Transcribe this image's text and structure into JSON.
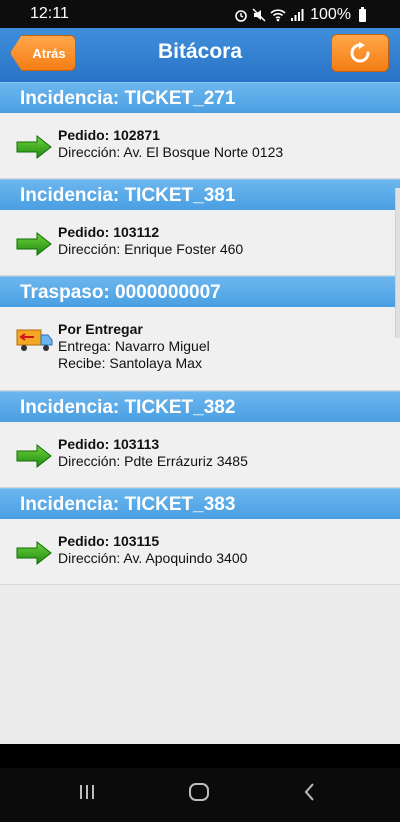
{
  "status": {
    "time": "12:11",
    "battery": "100%"
  },
  "header": {
    "back_label": "Atrás",
    "title": "Bitácora"
  },
  "sections": [
    {
      "title": "Incidencia: TICKET_271",
      "line1": "Pedido: 102871",
      "line2": "Dirección: Av. El Bosque Norte 0123"
    },
    {
      "title": "Incidencia: TICKET_381",
      "line1": "Pedido: 103112",
      "line2": "Dirección: Enrique Foster 460"
    },
    {
      "title": "Traspaso: 0000000007",
      "line1": "Por Entregar",
      "line2": "Entrega: Navarro Miguel",
      "line3": "Recibe: Santolaya Max"
    },
    {
      "title": "Incidencia: TICKET_382",
      "line1": "Pedido: 103113",
      "line2": "Dirección: Pdte Errázuriz 3485"
    },
    {
      "title": "Incidencia: TICKET_383",
      "line1": "Pedido: 103115",
      "line2": "Dirección: Av. Apoquindo 3400"
    }
  ],
  "icons": {
    "incidencia": "green-arrow-icon",
    "traspaso": "delivery-truck-icon"
  },
  "colors": {
    "header": "#2f7ed0",
    "section": "#5aa9e8",
    "button": "#f4871e"
  }
}
